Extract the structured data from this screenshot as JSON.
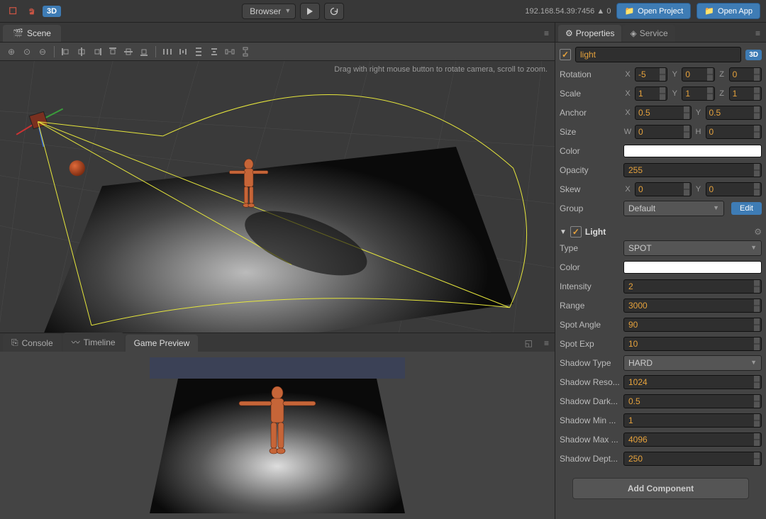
{
  "topbar": {
    "browser": "Browser",
    "ip": "192.168.54.39:7456",
    "signal": 0,
    "open_project": "Open Project",
    "open_app": "Open App",
    "badge3d": "3D"
  },
  "scene": {
    "tab": "Scene",
    "hint": "Drag with right mouse button to rotate camera, scroll to zoom."
  },
  "bottom_tabs": {
    "console": "Console",
    "timeline": "Timeline",
    "preview": "Game Preview"
  },
  "inspector": {
    "tab_properties": "Properties",
    "tab_service": "Service",
    "name": "light",
    "badge3d": "3D",
    "rotation_label": "Rotation",
    "rot": {
      "x": "-5",
      "y": "0",
      "z": "0"
    },
    "scale_label": "Scale",
    "scale": {
      "x": "1",
      "y": "1",
      "z": "1"
    },
    "anchor_label": "Anchor",
    "anchor": {
      "x": "0.5",
      "y": "0.5"
    },
    "size_label": "Size",
    "size": {
      "w": "0",
      "h": "0"
    },
    "color_label": "Color",
    "opacity_label": "Opacity",
    "opacity": "255",
    "skew_label": "Skew",
    "skew": {
      "x": "0",
      "y": "0"
    },
    "group_label": "Group",
    "group": "Default",
    "edit": "Edit",
    "light": {
      "title": "Light",
      "type_label": "Type",
      "type": "SPOT",
      "color_label": "Color",
      "intensity_label": "Intensity",
      "intensity": "2",
      "range_label": "Range",
      "range": "3000",
      "spot_angle_label": "Spot Angle",
      "spot_angle": "90",
      "spot_exp_label": "Spot Exp",
      "spot_exp": "10",
      "shadow_type_label": "Shadow Type",
      "shadow_type": "HARD",
      "shadow_res_label": "Shadow Reso...",
      "shadow_res": "1024",
      "shadow_dark_label": "Shadow Dark...",
      "shadow_dark": "0.5",
      "shadow_min_label": "Shadow Min ...",
      "shadow_min": "1",
      "shadow_max_label": "Shadow Max ...",
      "shadow_max": "4096",
      "shadow_depth_label": "Shadow Dept...",
      "shadow_depth": "250"
    },
    "add_component": "Add Component"
  }
}
